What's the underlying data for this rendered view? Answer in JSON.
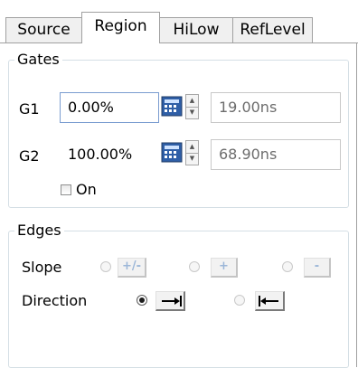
{
  "tabs": [
    {
      "label": "Source",
      "active": false
    },
    {
      "label": "Region",
      "active": true
    },
    {
      "label": "HiLow",
      "active": false
    },
    {
      "label": "RefLevel",
      "active": false
    }
  ],
  "gates": {
    "title": "Gates",
    "g1": {
      "label": "G1",
      "value": "0.00%",
      "time": "19.00ns"
    },
    "g2": {
      "label": "G2",
      "value": "100.00%",
      "time": "68.90ns"
    },
    "on": {
      "label": "On",
      "checked": false
    }
  },
  "edges": {
    "title": "Edges",
    "slope": {
      "label": "Slope",
      "options": [
        {
          "symbol": "+/-",
          "selected": false,
          "enabled": false
        },
        {
          "symbol": "+",
          "selected": false,
          "enabled": false
        },
        {
          "symbol": "-",
          "selected": false,
          "enabled": false
        }
      ]
    },
    "direction": {
      "label": "Direction",
      "options": [
        {
          "icon": "arrow-right-icon",
          "selected": true
        },
        {
          "icon": "arrow-left-icon",
          "selected": false
        }
      ]
    }
  },
  "colors": {
    "accent": "#1a5fb4",
    "disabled_accent": "#9bb6d8",
    "group_border": "#d5dfe5",
    "input_border": "#7a9cd0"
  },
  "icons": [
    "calculator-icon",
    "spin-up-icon",
    "spin-down-icon",
    "arrow-right-icon",
    "arrow-left-icon"
  ]
}
